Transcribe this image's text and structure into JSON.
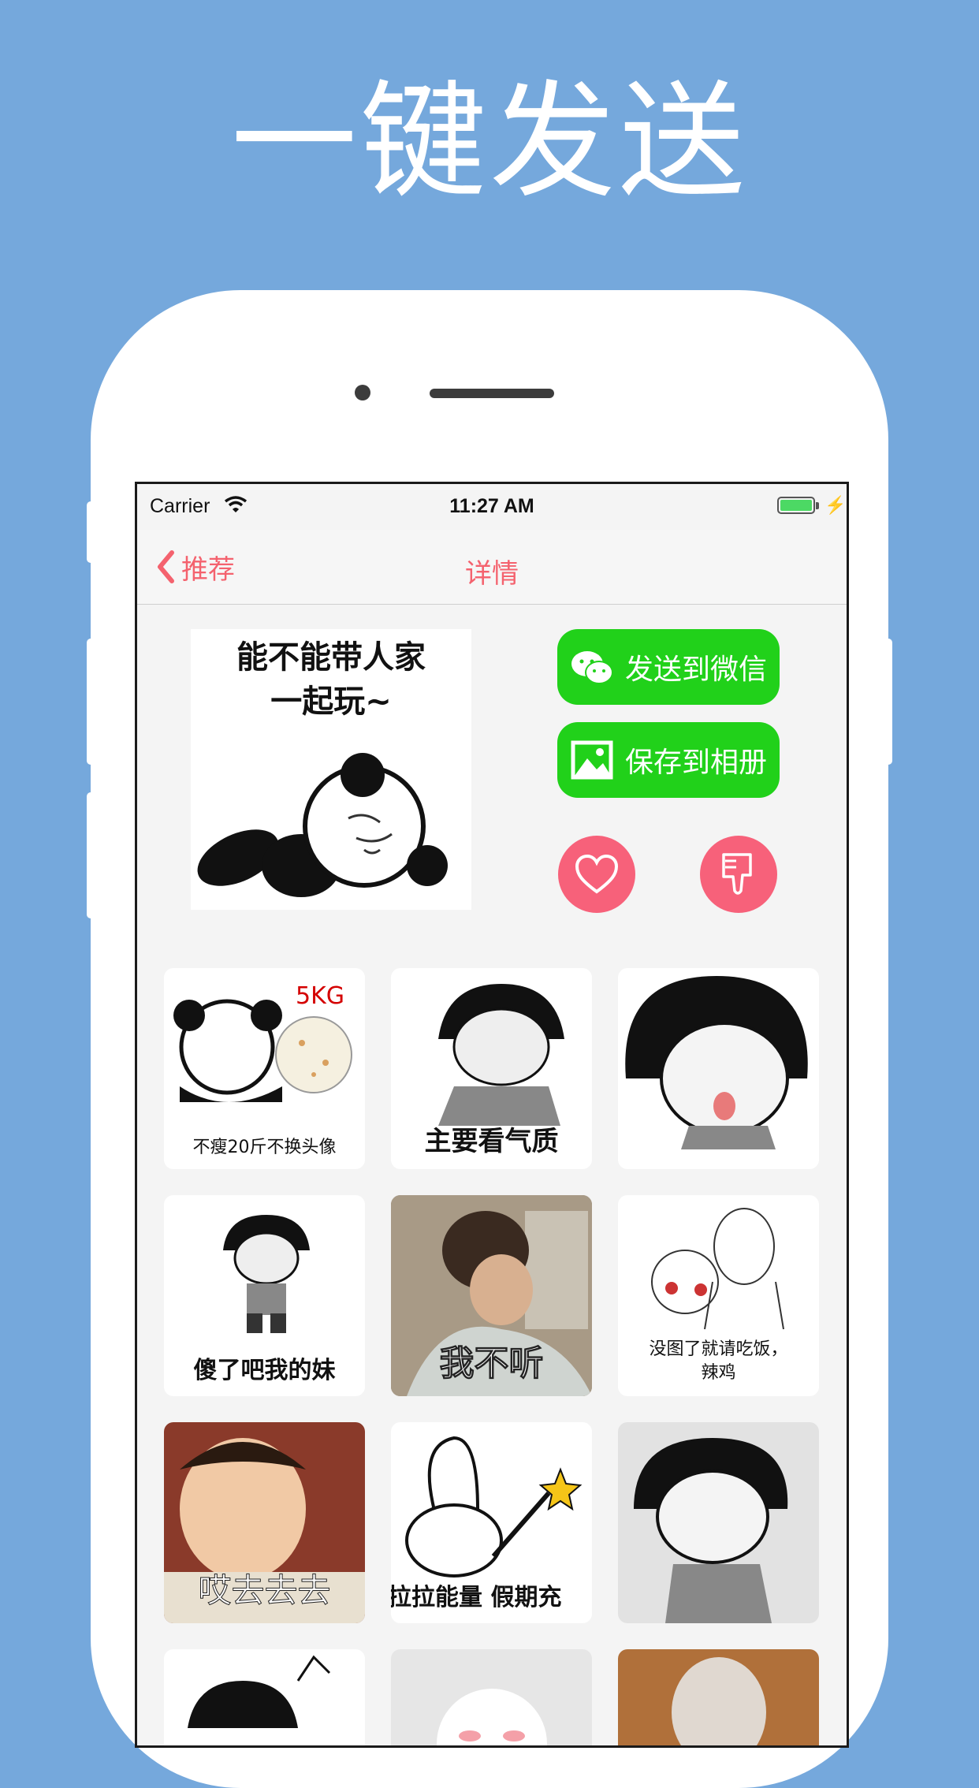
{
  "headline": "一键发送",
  "status_bar": {
    "carrier": "Carrier",
    "time": "11:27 AM"
  },
  "nav": {
    "back_label": "推荐",
    "title": "详情"
  },
  "detail": {
    "caption_line1": "能不能带人家",
    "caption_line2": "一起玩~",
    "send_wechat_label": "发送到微信",
    "save_album_label": "保存到相册"
  },
  "grid": [
    {
      "caption": "不瘦20斤不换头像",
      "badge": "5KG"
    },
    {
      "caption": "主要看气质"
    },
    {
      "caption": ""
    },
    {
      "caption": "傻了吧我的妹"
    },
    {
      "caption": "我不听"
    },
    {
      "caption_line1": "没图了就请吃饭，",
      "caption_line2": "辣鸡"
    },
    {
      "caption": "哎去去去"
    },
    {
      "caption": "拉拉能量 假期充"
    },
    {
      "caption": ""
    },
    {
      "caption": ""
    },
    {
      "caption": ""
    },
    {
      "caption": ""
    }
  ],
  "colors": {
    "background": "#75a8dc",
    "accent": "#f4626e",
    "green": "#21d11a",
    "pink": "#f7617a"
  }
}
